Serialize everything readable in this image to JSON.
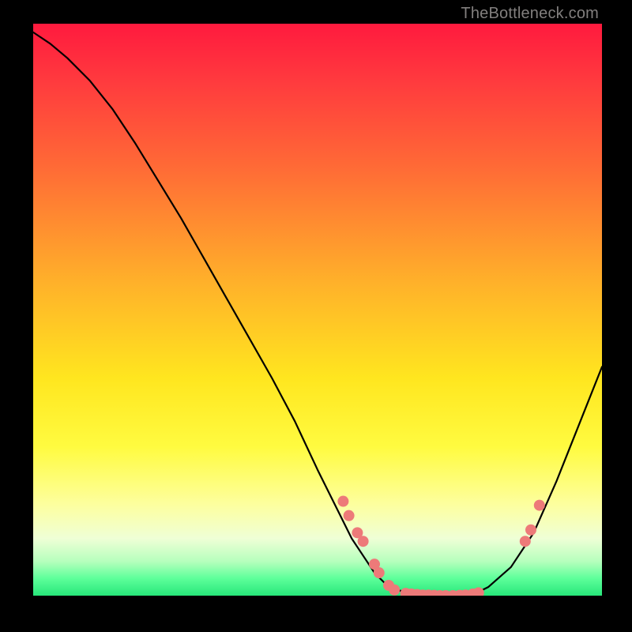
{
  "attribution": "TheBottleneck.com",
  "colors": {
    "dot": "#ed7a79",
    "curve": "#000000",
    "background": "#000000",
    "gradient_top": "#ff1a3e",
    "gradient_mid": "#ffe61f",
    "gradient_bottom": "#27e67a"
  },
  "chart_data": {
    "type": "line",
    "title": "",
    "subtitle": "",
    "xlabel": "",
    "ylabel": "",
    "xlim": [
      0,
      100
    ],
    "ylim": [
      0,
      100
    ],
    "grid": false,
    "legend": false,
    "annotations": [],
    "curve_note": "V-shaped cost/mismatch curve; x axis reads left→right 0..100, y axis reads 0 at bottom, 100 at top. Values are estimated from pixel position.",
    "x": [
      0,
      3,
      6,
      10,
      14,
      18,
      22,
      26,
      30,
      34,
      38,
      42,
      46,
      50,
      54,
      56,
      58,
      60,
      62,
      64,
      66,
      68,
      70,
      72,
      74,
      76,
      78,
      80,
      84,
      88,
      92,
      96,
      100
    ],
    "y": [
      98.5,
      96.5,
      94,
      90,
      85,
      79,
      72.5,
      66,
      59,
      52,
      45,
      38,
      30.5,
      22,
      14,
      10,
      7,
      4,
      2,
      1,
      0.5,
      0.3,
      0.1,
      0,
      0,
      0.2,
      0.5,
      1.5,
      5,
      11,
      20,
      30,
      40
    ],
    "dots_note": "Highlighted sample points (x position in percent, y in percent).",
    "dots": [
      {
        "x": 54.5,
        "y": 16.5
      },
      {
        "x": 55.5,
        "y": 14.0
      },
      {
        "x": 57.0,
        "y": 11.0
      },
      {
        "x": 58.0,
        "y": 9.5
      },
      {
        "x": 60.0,
        "y": 5.5
      },
      {
        "x": 60.8,
        "y": 4.0
      },
      {
        "x": 62.5,
        "y": 1.8
      },
      {
        "x": 63.5,
        "y": 1.0
      },
      {
        "x": 65.5,
        "y": 0.4
      },
      {
        "x": 66.5,
        "y": 0.3
      },
      {
        "x": 67.5,
        "y": 0.2
      },
      {
        "x": 68.5,
        "y": 0.1
      },
      {
        "x": 69.5,
        "y": 0.1
      },
      {
        "x": 70.5,
        "y": 0.05
      },
      {
        "x": 71.5,
        "y": 0.0
      },
      {
        "x": 72.5,
        "y": 0.0
      },
      {
        "x": 73.8,
        "y": 0.0
      },
      {
        "x": 75.0,
        "y": 0.05
      },
      {
        "x": 76.0,
        "y": 0.1
      },
      {
        "x": 77.3,
        "y": 0.3
      },
      {
        "x": 78.3,
        "y": 0.5
      },
      {
        "x": 86.5,
        "y": 9.5
      },
      {
        "x": 87.5,
        "y": 11.5
      },
      {
        "x": 89.0,
        "y": 15.8
      }
    ]
  }
}
